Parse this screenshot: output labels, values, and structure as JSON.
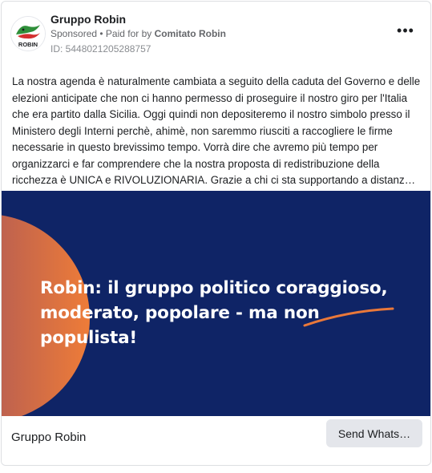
{
  "ad": {
    "page_name": "Gruppo Robin",
    "sponsored_label": "Sponsored",
    "separator": " • ",
    "paid_for_prefix": "Paid for by ",
    "paid_for_by": "Comitato Robin",
    "ad_id": "ID: 5448021205288757",
    "more_icon": "•••",
    "avatar_text": "ROBIN",
    "body_text": "La nostra agenda è naturalmente cambiata a seguito della caduta del Governo e delle elezioni anticipate che non ci hanno permesso di proseguire il nostro giro per l'Italia che era partito dalla Sicilia. Oggi quindi non depositeremo il nostro simbolo presso il Ministero degli Interni perchè, ahimè, non saremmo riusciti a raccogliere le firme necessarie in questo brevissimo tempo. Vorrà dire che avremo più tempo per organizzarci e far comprendere che la nostra proposta di redistribuzione della ricchezza è UNICA e RIVOLUZIONARIA. Grazie a chi ci sta supportando a distanz…"
  },
  "creative": {
    "headline_line1": "Robin: il gruppo politico coraggioso,",
    "headline_line2_a": "moderato, popolare - ma non ",
    "headline_line2_b": "populista",
    "headline_line2_c": "!",
    "background_color": "#0f2466",
    "accent_color": "#e9783a"
  },
  "footer": {
    "page_name": "Gruppo Robin",
    "cta_label": "Send Whats…"
  }
}
